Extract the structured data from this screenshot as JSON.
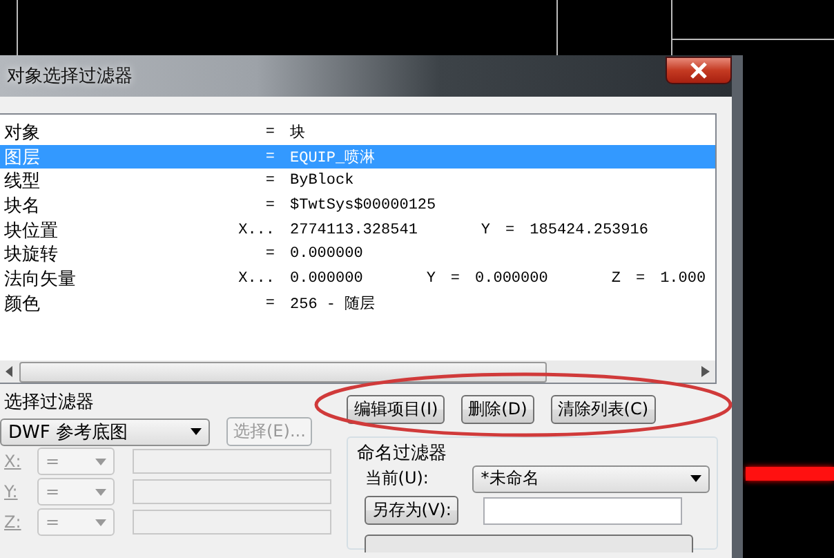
{
  "window": {
    "title": "对象选择过滤器"
  },
  "filter_list": {
    "rows": [
      {
        "name": "对象",
        "operator": "=",
        "value": "块",
        "selected": false,
        "components": []
      },
      {
        "name": "图层",
        "operator": "=",
        "value": "EQUIP_喷淋",
        "selected": true,
        "components": []
      },
      {
        "name": "线型",
        "operator": "=",
        "value": "ByBlock",
        "selected": false,
        "components": []
      },
      {
        "name": "块名",
        "operator": "=",
        "value": "$TwtSys$00000125",
        "selected": false,
        "components": []
      },
      {
        "name": "块位置",
        "operator": "X...",
        "value": "2774113.328541",
        "selected": false,
        "components": [
          {
            "axis": "Y",
            "operator": "=",
            "value": "185424.253916"
          }
        ]
      },
      {
        "name": "块旋转",
        "operator": "=",
        "value": "0.000000",
        "selected": false,
        "components": []
      },
      {
        "name": "法向矢量",
        "operator": "X...",
        "value": "0.000000",
        "selected": false,
        "components": [
          {
            "axis": "Y",
            "operator": "=",
            "value": "0.000000"
          },
          {
            "axis": "Z",
            "operator": "=",
            "value": "1.000"
          }
        ]
      },
      {
        "name": "颜色",
        "operator": "=",
        "value": "256 - 随层",
        "selected": false,
        "components": []
      }
    ]
  },
  "select_filter": {
    "label": "选择过滤器",
    "dropdown": "DWF 参考底图",
    "select_button": {
      "label": "选择(E)...",
      "disabled": true
    },
    "coordinates": [
      {
        "label": "X:",
        "operator": "=",
        "disabled": true
      },
      {
        "label": "Y:",
        "operator": "=",
        "disabled": true
      },
      {
        "label": "Z:",
        "operator": "=",
        "disabled": true
      }
    ]
  },
  "buttons": [
    {
      "label": "编辑项目(I)"
    },
    {
      "label": "删除(D)"
    },
    {
      "label": "清除列表(C)"
    }
  ],
  "named_filters": {
    "label": "命名过滤器",
    "current_label": "当前(U):",
    "current_value": "*未命名",
    "save_as_button": "另存为(V):"
  }
}
